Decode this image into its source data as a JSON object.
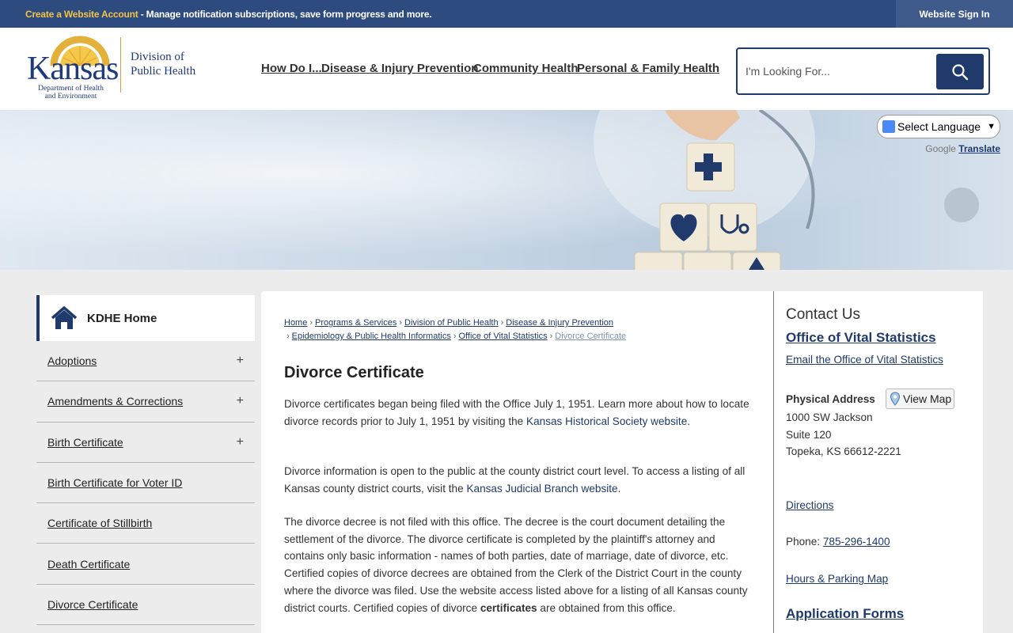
{
  "topbar": {
    "account_link": "Create a Website Account",
    "account_desc": " - Manage notification subscriptions, save form progress and more.",
    "signin": "Website Sign In"
  },
  "logo": {
    "state": "Kansas",
    "dept_line1": "Department of Health",
    "dept_line2": "and Environment",
    "division_line1": "Division of",
    "division_line2": "Public Health"
  },
  "nav": {
    "items": [
      "How Do I...",
      "Disease & Injury Prevention",
      "Community Health",
      "Personal & Family Health"
    ]
  },
  "search": {
    "placeholder": "I'm Looking For..."
  },
  "translate": {
    "select_label": "Select Language",
    "powered_by": "Google",
    "translate_link": "Translate"
  },
  "sidebar": {
    "home": "KDHE Home",
    "items": [
      {
        "label": "Adoptions",
        "expand": "+"
      },
      {
        "label": "Amendments & Corrections",
        "expand": "+"
      },
      {
        "label": "Birth Certificate",
        "expand": "+"
      },
      {
        "label": "Birth Certificate for Voter ID",
        "expand": ""
      },
      {
        "label": "Certificate of Stillbirth",
        "expand": ""
      },
      {
        "label": "Death Certificate",
        "expand": ""
      },
      {
        "label": "Divorce Certificate",
        "expand": ""
      }
    ]
  },
  "breadcrumbs": {
    "home": "Home",
    "programs": "Programs & Services",
    "division": "Division of Public Health",
    "disease": "Disease & Injury Prevention",
    "epi": "Epidemiology & Public Health Informatics",
    "ovs": "Office of Vital Statistics",
    "current": "Divorce Certificate",
    "separator": "›"
  },
  "main": {
    "title": "Divorce Certificate",
    "p1_text": "Divorce certificates began being filed with the Office July 1, 1951. Learn more about how to locate divorce records prior to July 1, 1951 by visiting the ",
    "p1_link": "Kansas Historical Society website",
    "p1_end": ".",
    "p2_text": "Divorce information is open to the public at the county district court level. To access a listing of all Kansas county district courts, visit the ",
    "p2_link": "Kansas Judicial Branch website",
    "p2_end": ".",
    "p3_text": "The divorce decree is not filed with this office. The decree is the court document detailing the settlement of the divorce. The divorce certificate is completed by the plaintiff's attorney and contains only basic information - names of both parties, date of marriage, date of divorce, etc. Certified copies of divorce decrees are obtained from the Clerk of the District Court in the county where the divorce was filed. Use the website access listed above for a listing of all Kansas county district courts. Certified copies of divorce ",
    "p3_bold": "certificates",
    "p3_end": " are obtained from this office."
  },
  "contact": {
    "title": "Contact Us",
    "office": "Office of Vital Statistics",
    "email": "Email the Office of Vital Statistics",
    "address_label": "Physical Address",
    "view_map": "View Map",
    "address_line1": "1000 SW Jackson",
    "address_line2": "Suite 120",
    "address_line3": "Topeka, KS 66612-2221",
    "directions": "Directions",
    "phone_label": "Phone: ",
    "phone": "785-296-1400",
    "hours": "Hours & Parking Map",
    "app_forms": "Application Forms"
  },
  "colors": {
    "topbar": "#2d4b7e",
    "accent": "#1f3a6b",
    "highlight": "#f2c349"
  }
}
